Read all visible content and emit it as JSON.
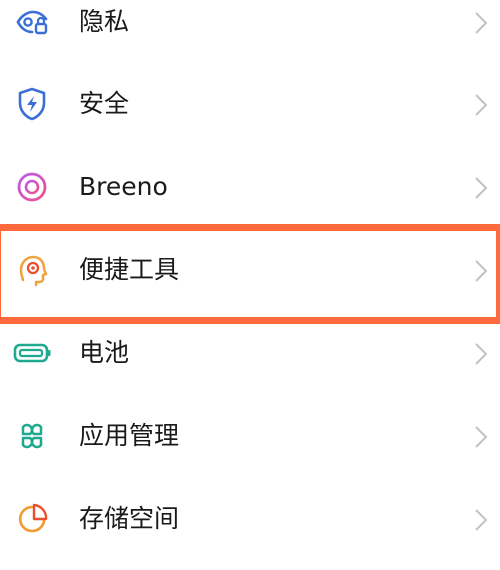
{
  "settings_list": {
    "items": [
      {
        "label": "隐私",
        "icon": "privacy-eye-lock-icon"
      },
      {
        "label": "安全",
        "icon": "security-shield-icon"
      },
      {
        "label": "Breeno",
        "icon": "breeno-ring-icon"
      },
      {
        "label": "便捷工具",
        "icon": "convenience-tools-head-icon"
      },
      {
        "label": "电池",
        "icon": "battery-icon"
      },
      {
        "label": "应用管理",
        "icon": "app-management-icon"
      },
      {
        "label": "存储空间",
        "icon": "storage-pie-icon"
      }
    ]
  },
  "highlight": {
    "color": "#ff6a3d",
    "target_item": "便捷工具"
  },
  "colors": {
    "privacy": "#3a6fd8",
    "security": "#3b6fd6",
    "breeno": "#d74fb3",
    "tools": "#f2a23b",
    "battery": "#1fa98f",
    "apps": "#1fa98f",
    "storage": "#f29a2e",
    "chevron": "#c2c2c2",
    "text": "#1a1a1a"
  }
}
